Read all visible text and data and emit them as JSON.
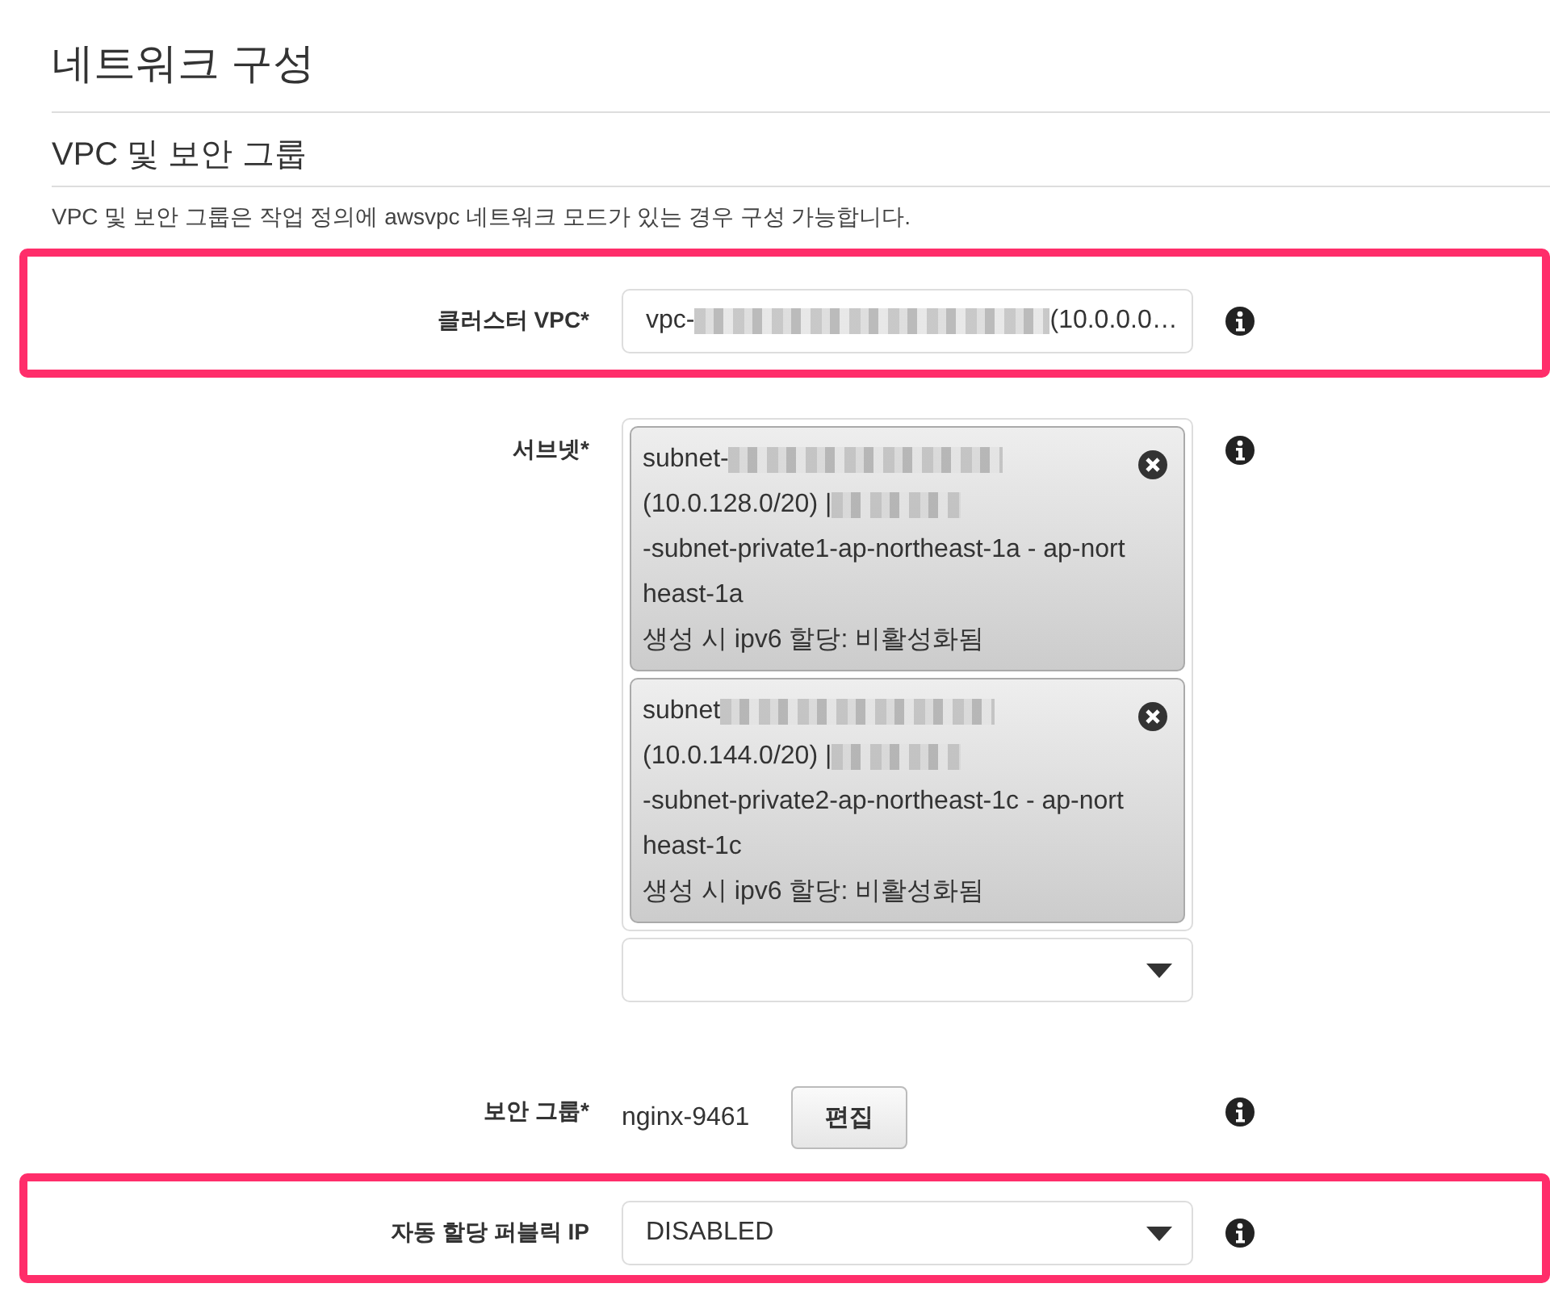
{
  "title": "네트워크 구성",
  "section": {
    "title": "VPC 및 보안 그룹",
    "description": "VPC 및 보안 그룹은 작업 정의에 awsvpc 네트워크 모드가 있는 경우 구성 가능합니다."
  },
  "fields": [
    {
      "kind": "select",
      "label": "클러스터 VPC*",
      "highlighted": true,
      "value_prefix": "vpc-",
      "value_suffix": "(10.0.0.0…"
    },
    {
      "kind": "multiselect",
      "label": "서브넷*",
      "highlighted": false,
      "chips": [
        {
          "prefix": "subnet-",
          "cidr": "(10.0.128.0/20) |",
          "name": "-subnet-private1-ap-northeast-1a - ap-northeast-1a",
          "ipv6": "생성 시 ipv6 할당: 비활성화됨"
        },
        {
          "prefix": "subnet",
          "cidr": "(10.0.144.0/20) |",
          "name": "-subnet-private2-ap-northeast-1c - ap-northeast-1c",
          "ipv6": "생성 시 ipv6 할당: 비활성화됨"
        }
      ]
    },
    {
      "kind": "group",
      "label": "보안 그룹*",
      "highlighted": false,
      "value": "nginx-9461",
      "button": "편집"
    },
    {
      "kind": "select",
      "label": "자동 할당 퍼블릭 IP",
      "highlighted": true,
      "value": "DISABLED"
    }
  ]
}
